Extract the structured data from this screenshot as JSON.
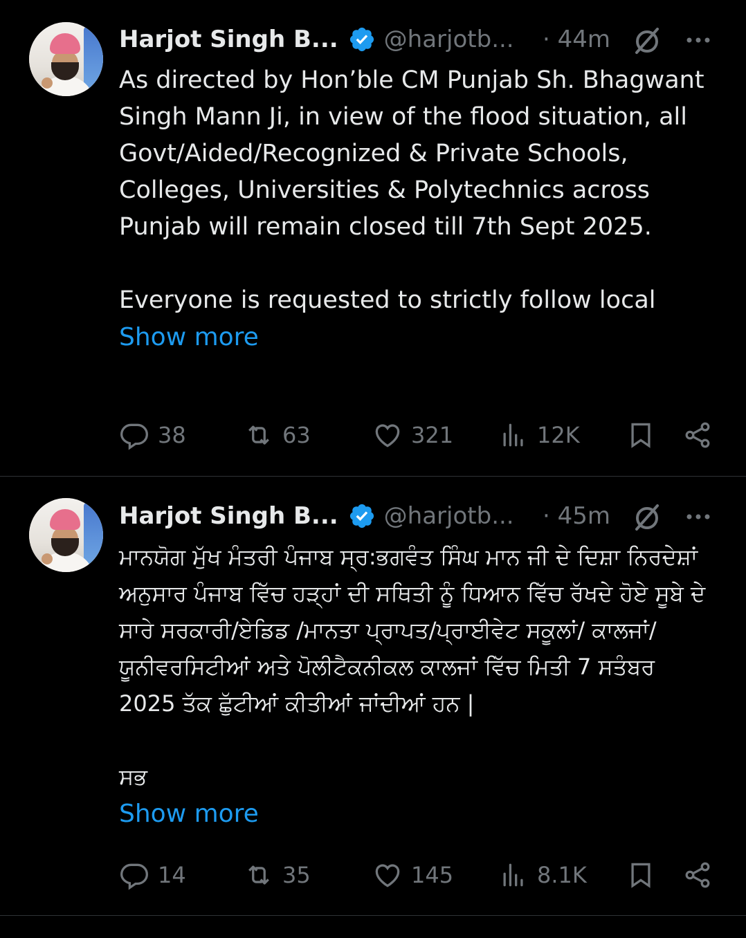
{
  "tweets": [
    {
      "author_name": "Harjot Singh B...",
      "handle": "@harjotb...",
      "time": "· 44m",
      "paragraphs": [
        "As directed by Hon’ble CM Punjab Sh. Bhagwant Singh Mann Ji, in view of the flood situation, all Govt/Aided/Recognized & Private Schools, Colleges, Universities & Polytechnics across Punjab will remain closed till 7th Sept 2025.",
        "Everyone is requested to strictly follow local"
      ],
      "show_more": "Show more",
      "replies": "38",
      "reposts": "63",
      "likes": "321",
      "views": "12K"
    },
    {
      "author_name": "Harjot Singh B...",
      "handle": "@harjotb...",
      "time": "· 45m",
      "paragraphs": [
        "ਮਾਨਯੋਗ ਮੁੱਖ ਮੰਤਰੀ ਪੰਜਾਬ ਸ੍ਰ:ਭਗਵੰਤ ਸਿੰਘ ਮਾਨ ਜੀ ਦੇ ਦਿਸ਼ਾ ਨਿਰਦੇਸ਼ਾਂ ਅਨੁਸਾਰ ਪੰਜਾਬ ਵਿੱਚ ਹੜ੍ਹਾਂ ਦੀ ਸਥਿਤੀ ਨੂੰ ਧਿਆਨ ਵਿੱਚ ਰੱਖਦੇ ਹੋਏ ਸੂਬੇ ਦੇ ਸਾਰੇ ਸਰਕਾਰੀ/ਏਡਿਡ /ਮਾਨਤਾ ਪ੍ਰਾਪਤ/ਪ੍ਰਾਈਵੇਟ ਸਕੂਲਾਂ/ ਕਾਲਜਾਂ/ਯੂਨੀਵਰਸਿਟੀਆਂ ਅਤੇ ਪੋਲੀਟੈਕਨੀਕਲ ਕਾਲਜਾਂ ਵਿੱਚ ਮਿਤੀ 7 ਸਤੰਬਰ 2025 ਤੱਕ ਛੁੱਟੀਆਂ ਕੀਤੀਆਂ ਜਾਂਦੀਆਂ ਹਨ |",
        "ਸਭ"
      ],
      "show_more": "Show more",
      "replies": "14",
      "reposts": "35",
      "likes": "145",
      "views": "8.1K"
    }
  ],
  "icons": [
    "verified-badge-icon",
    "grok-icon",
    "more-icon",
    "reply-icon",
    "repost-icon",
    "like-icon",
    "views-icon",
    "bookmark-icon",
    "share-icon"
  ],
  "colors": {
    "background": "#000000",
    "text": "#e7e9ea",
    "secondary": "#71767b",
    "link": "#1d9bf0",
    "verified": "#1d9bf0"
  }
}
